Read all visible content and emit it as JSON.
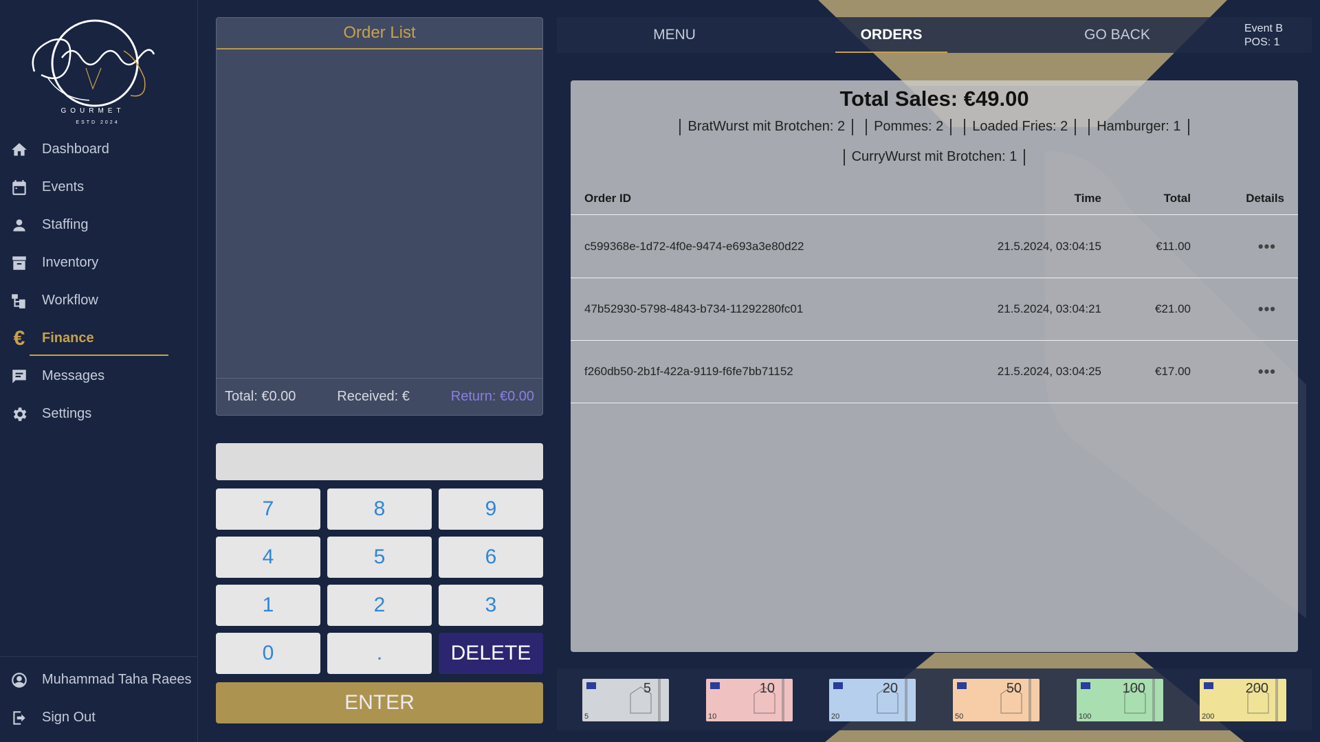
{
  "brand": {
    "logo_script": "Geschäfts",
    "logo_sub": "GOURMET",
    "logo_estd": "ESTD 2024"
  },
  "sidebar": {
    "items": [
      {
        "label": "Dashboard",
        "icon": "home-icon"
      },
      {
        "label": "Events",
        "icon": "calendar-icon"
      },
      {
        "label": "Staffing",
        "icon": "person-icon"
      },
      {
        "label": "Inventory",
        "icon": "archive-icon"
      },
      {
        "label": "Workflow",
        "icon": "workflow-icon"
      },
      {
        "label": "Finance",
        "icon": "euro-icon",
        "active": true
      },
      {
        "label": "Messages",
        "icon": "message-icon"
      },
      {
        "label": "Settings",
        "icon": "gear-icon"
      }
    ],
    "user": {
      "label": "Muhammad Taha Raees",
      "icon": "user-circle-icon"
    },
    "signout": {
      "label": "Sign Out",
      "icon": "sign-out-icon"
    },
    "accent_color": "#c9a14a"
  },
  "order_list": {
    "title": "Order List",
    "total_label": "Total: €0.00",
    "received_label": "Received: €",
    "return_label": "Return: €0.00"
  },
  "keypad": {
    "input_value": "",
    "keys": [
      "7",
      "8",
      "9",
      "4",
      "5",
      "6",
      "1",
      "2",
      "3",
      "0",
      ".",
      "DELETE"
    ],
    "enter_label": "ENTER"
  },
  "tabs": {
    "menu": "MENU",
    "orders": "ORDERS",
    "go_back": "GO BACK",
    "active": "ORDERS"
  },
  "event": {
    "name": "Event B",
    "pos": "POS: 1"
  },
  "orders": {
    "total_sales": "Total Sales: €49.00",
    "summary_line1": [
      "BratWurst mit Brotchen: 2",
      "Pommes: 2",
      "Loaded Fries: 2",
      "Hamburger: 1"
    ],
    "summary_line2": [
      "CurryWurst mit Brotchen: 1"
    ],
    "columns": {
      "id": "Order ID",
      "time": "Time",
      "total": "Total",
      "details": "Details"
    },
    "rows": [
      {
        "id": "c599368e-1d72-4f0e-9474-e693a3e80d22",
        "time": "21.5.2024, 03:04:15",
        "total": "€11.00",
        "details": "•••"
      },
      {
        "id": "47b52930-5798-4843-b734-11292280fc01",
        "time": "21.5.2024, 03:04:21",
        "total": "€21.00",
        "details": "•••"
      },
      {
        "id": "f260db50-2b1f-422a-9119-f6fe7bb71152",
        "time": "21.5.2024, 03:04:25",
        "total": "€17.00",
        "details": "•••"
      }
    ]
  },
  "banknotes": [
    {
      "value": "5",
      "color": "#b9bdc4"
    },
    {
      "value": "10",
      "color": "#e8a0a0"
    },
    {
      "value": "20",
      "color": "#8fb6e2"
    },
    {
      "value": "50",
      "color": "#f2b278"
    },
    {
      "value": "100",
      "color": "#7ccc86"
    },
    {
      "value": "200",
      "color": "#e8d460"
    }
  ]
}
